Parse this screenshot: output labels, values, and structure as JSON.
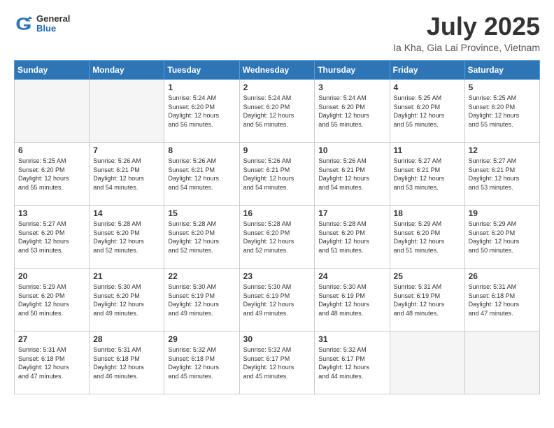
{
  "header": {
    "logo": {
      "general": "General",
      "blue": "Blue"
    },
    "title": "July 2025",
    "location": "Ia Kha, Gia Lai Province, Vietnam"
  },
  "weekdays": [
    "Sunday",
    "Monday",
    "Tuesday",
    "Wednesday",
    "Thursday",
    "Friday",
    "Saturday"
  ],
  "weeks": [
    [
      {
        "day": null,
        "info": null
      },
      {
        "day": null,
        "info": null
      },
      {
        "day": "1",
        "info": "Sunrise: 5:24 AM\nSunset: 6:20 PM\nDaylight: 12 hours\nand 56 minutes."
      },
      {
        "day": "2",
        "info": "Sunrise: 5:24 AM\nSunset: 6:20 PM\nDaylight: 12 hours\nand 56 minutes."
      },
      {
        "day": "3",
        "info": "Sunrise: 5:24 AM\nSunset: 6:20 PM\nDaylight: 12 hours\nand 55 minutes."
      },
      {
        "day": "4",
        "info": "Sunrise: 5:25 AM\nSunset: 6:20 PM\nDaylight: 12 hours\nand 55 minutes."
      },
      {
        "day": "5",
        "info": "Sunrise: 5:25 AM\nSunset: 6:20 PM\nDaylight: 12 hours\nand 55 minutes."
      }
    ],
    [
      {
        "day": "6",
        "info": "Sunrise: 5:25 AM\nSunset: 6:20 PM\nDaylight: 12 hours\nand 55 minutes."
      },
      {
        "day": "7",
        "info": "Sunrise: 5:26 AM\nSunset: 6:21 PM\nDaylight: 12 hours\nand 54 minutes."
      },
      {
        "day": "8",
        "info": "Sunrise: 5:26 AM\nSunset: 6:21 PM\nDaylight: 12 hours\nand 54 minutes."
      },
      {
        "day": "9",
        "info": "Sunrise: 5:26 AM\nSunset: 6:21 PM\nDaylight: 12 hours\nand 54 minutes."
      },
      {
        "day": "10",
        "info": "Sunrise: 5:26 AM\nSunset: 6:21 PM\nDaylight: 12 hours\nand 54 minutes."
      },
      {
        "day": "11",
        "info": "Sunrise: 5:27 AM\nSunset: 6:21 PM\nDaylight: 12 hours\nand 53 minutes."
      },
      {
        "day": "12",
        "info": "Sunrise: 5:27 AM\nSunset: 6:21 PM\nDaylight: 12 hours\nand 53 minutes."
      }
    ],
    [
      {
        "day": "13",
        "info": "Sunrise: 5:27 AM\nSunset: 6:20 PM\nDaylight: 12 hours\nand 53 minutes."
      },
      {
        "day": "14",
        "info": "Sunrise: 5:28 AM\nSunset: 6:20 PM\nDaylight: 12 hours\nand 52 minutes."
      },
      {
        "day": "15",
        "info": "Sunrise: 5:28 AM\nSunset: 6:20 PM\nDaylight: 12 hours\nand 52 minutes."
      },
      {
        "day": "16",
        "info": "Sunrise: 5:28 AM\nSunset: 6:20 PM\nDaylight: 12 hours\nand 52 minutes."
      },
      {
        "day": "17",
        "info": "Sunrise: 5:28 AM\nSunset: 6:20 PM\nDaylight: 12 hours\nand 51 minutes."
      },
      {
        "day": "18",
        "info": "Sunrise: 5:29 AM\nSunset: 6:20 PM\nDaylight: 12 hours\nand 51 minutes."
      },
      {
        "day": "19",
        "info": "Sunrise: 5:29 AM\nSunset: 6:20 PM\nDaylight: 12 hours\nand 50 minutes."
      }
    ],
    [
      {
        "day": "20",
        "info": "Sunrise: 5:29 AM\nSunset: 6:20 PM\nDaylight: 12 hours\nand 50 minutes."
      },
      {
        "day": "21",
        "info": "Sunrise: 5:30 AM\nSunset: 6:20 PM\nDaylight: 12 hours\nand 49 minutes."
      },
      {
        "day": "22",
        "info": "Sunrise: 5:30 AM\nSunset: 6:19 PM\nDaylight: 12 hours\nand 49 minutes."
      },
      {
        "day": "23",
        "info": "Sunrise: 5:30 AM\nSunset: 6:19 PM\nDaylight: 12 hours\nand 49 minutes."
      },
      {
        "day": "24",
        "info": "Sunrise: 5:30 AM\nSunset: 6:19 PM\nDaylight: 12 hours\nand 48 minutes."
      },
      {
        "day": "25",
        "info": "Sunrise: 5:31 AM\nSunset: 6:19 PM\nDaylight: 12 hours\nand 48 minutes."
      },
      {
        "day": "26",
        "info": "Sunrise: 5:31 AM\nSunset: 6:18 PM\nDaylight: 12 hours\nand 47 minutes."
      }
    ],
    [
      {
        "day": "27",
        "info": "Sunrise: 5:31 AM\nSunset: 6:18 PM\nDaylight: 12 hours\nand 47 minutes."
      },
      {
        "day": "28",
        "info": "Sunrise: 5:31 AM\nSunset: 6:18 PM\nDaylight: 12 hours\nand 46 minutes."
      },
      {
        "day": "29",
        "info": "Sunrise: 5:32 AM\nSunset: 6:18 PM\nDaylight: 12 hours\nand 45 minutes."
      },
      {
        "day": "30",
        "info": "Sunrise: 5:32 AM\nSunset: 6:17 PM\nDaylight: 12 hours\nand 45 minutes."
      },
      {
        "day": "31",
        "info": "Sunrise: 5:32 AM\nSunset: 6:17 PM\nDaylight: 12 hours\nand 44 minutes."
      },
      {
        "day": null,
        "info": null
      },
      {
        "day": null,
        "info": null
      }
    ]
  ]
}
